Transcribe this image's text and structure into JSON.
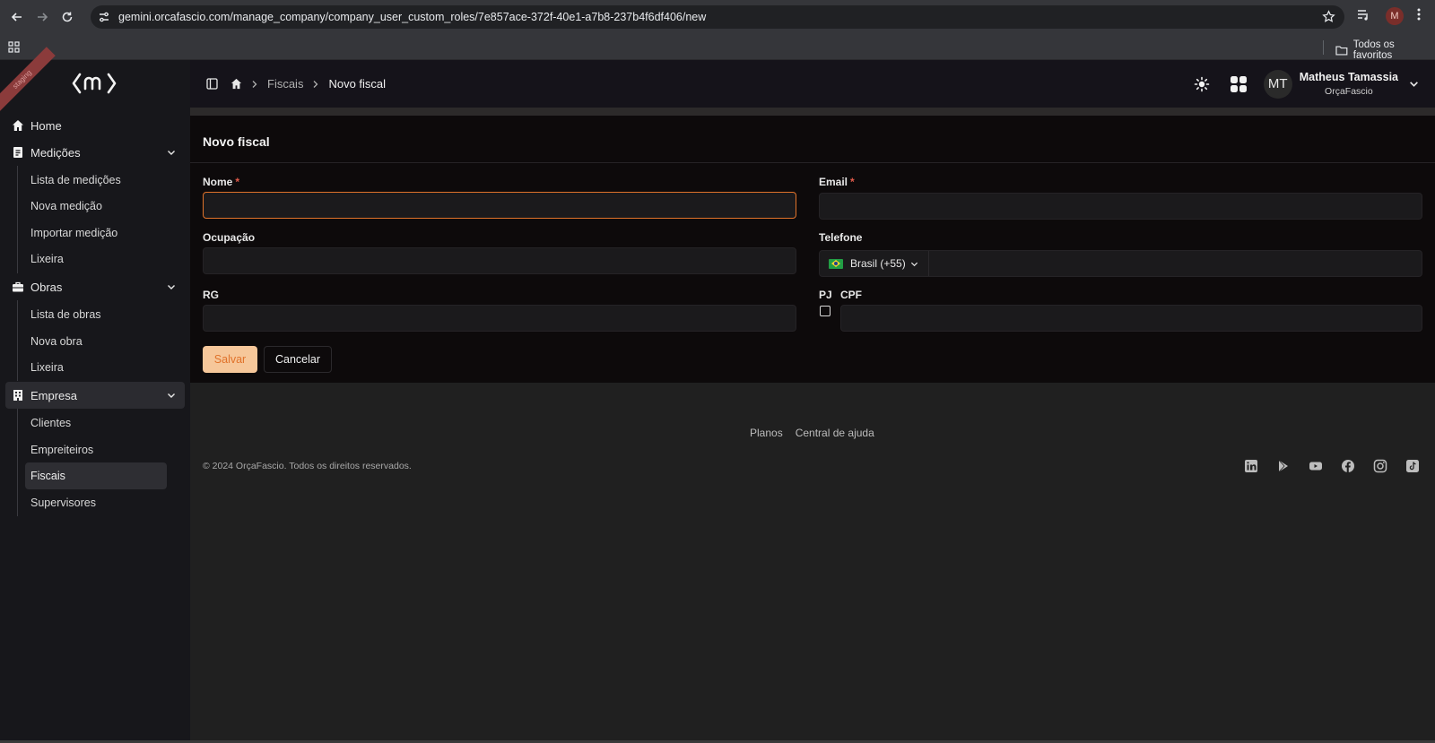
{
  "browser": {
    "url": "gemini.orcafascio.com/manage_company/company_user_custom_roles/7e857ace-372f-40e1-a7b8-237b4f6df406/new",
    "profile_initial": "M",
    "bookmarks_all": "Todos os favoritos"
  },
  "sidebar": {
    "ribbon": "staging",
    "items": [
      {
        "label": "Home"
      },
      {
        "label": "Medições",
        "children": [
          "Lista de medições",
          "Nova medição",
          "Importar medição",
          "Lixeira"
        ]
      },
      {
        "label": "Obras",
        "children": [
          "Lista de obras",
          "Nova obra",
          "Lixeira"
        ]
      },
      {
        "label": "Empresa",
        "children": [
          "Clientes",
          "Empreiteiros",
          "Fiscais",
          "Supervisores"
        ]
      }
    ]
  },
  "header": {
    "breadcrumb": [
      "Fiscais",
      "Novo fiscal"
    ],
    "user_initials": "MT",
    "user_name": "Matheus Tamassia",
    "user_company": "OrçaFascio"
  },
  "form": {
    "title": "Novo fiscal",
    "nome_label": "Nome",
    "email_label": "Email",
    "ocupacao_label": "Ocupação",
    "telefone_label": "Telefone",
    "country_value": "Brasil (+55)",
    "rg_label": "RG",
    "pj_label": "PJ",
    "cpf_label": "CPF",
    "required_mark": "*",
    "save_label": "Salvar",
    "cancel_label": "Cancelar"
  },
  "footer": {
    "links": [
      "Planos",
      "Central de ajuda"
    ],
    "copyright": "© 2024 OrçaFascio. Todos os direitos reservados.",
    "socials": [
      "linkedin-icon",
      "google-play-icon",
      "youtube-icon",
      "facebook-icon",
      "instagram-icon",
      "tiktok-icon"
    ]
  },
  "colors": {
    "accent": "#e0722a",
    "save_bg": "#f6c79a",
    "required": "#e25b4b"
  }
}
